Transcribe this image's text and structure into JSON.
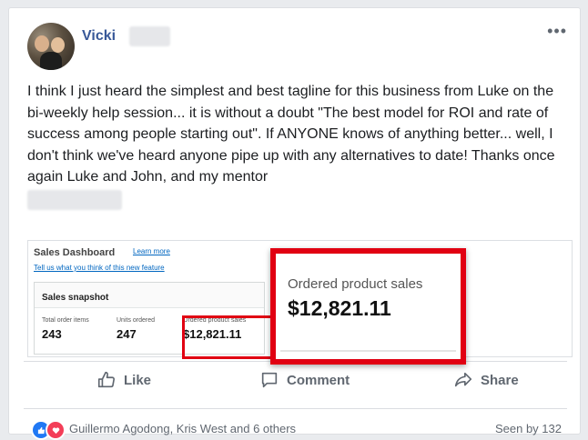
{
  "post": {
    "author": "Vicki",
    "more_options": "•••",
    "text": "I think I just heard the simplest and best tagline for this business from Luke on the bi-weekly help session... it is without a doubt \"The best model for ROI and rate of success among people starting out\". If ANYONE knows of anything better... well, I don't think we've heard anyone pipe up with any alternatives to date! Thanks once again Luke and John, and my mentor"
  },
  "attachment": {
    "dashboard_title": "Sales Dashboard",
    "learn_more": "Learn more",
    "feedback_link": "Tell us what you think of this new feature",
    "snapshot_title": "Sales snapshot",
    "metrics": [
      {
        "label": "Total order items",
        "value": "243"
      },
      {
        "label": "Units ordered",
        "value": "247"
      },
      {
        "label": "Ordered product sales",
        "value": "$12,821.11"
      }
    ],
    "zoom": {
      "label": "Ordered product sales",
      "value": "$12,821.11"
    }
  },
  "actions": {
    "like": "Like",
    "comment": "Comment",
    "share": "Share"
  },
  "footer": {
    "reactors": "Guillermo Agodong, Kris West and 6 others",
    "seen_by": "Seen by 132"
  },
  "colors": {
    "author": "#385898",
    "highlight": "#e10012",
    "action_text": "#606770"
  }
}
